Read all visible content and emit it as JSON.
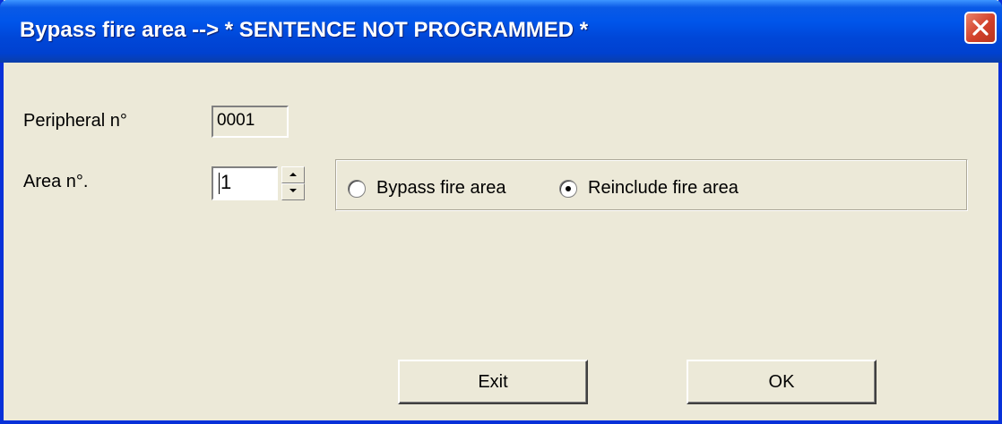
{
  "window": {
    "title": "Bypass fire area --> * SENTENCE NOT PROGRAMMED *",
    "close_icon": "close-x-icon"
  },
  "form": {
    "peripheral_label": "Peripheral n°",
    "peripheral_value": "0001",
    "area_label": "Area n°.",
    "area_value": "1"
  },
  "options": {
    "bypass_label": "Bypass fire area",
    "bypass_selected": false,
    "reinclude_label": "Reinclude fire area",
    "reinclude_selected": true
  },
  "buttons": {
    "exit_label": "Exit",
    "ok_label": "OK"
  },
  "colors": {
    "titlebar": "#0055ea",
    "window_face": "#ece9d8",
    "close_button": "#d2402a"
  }
}
